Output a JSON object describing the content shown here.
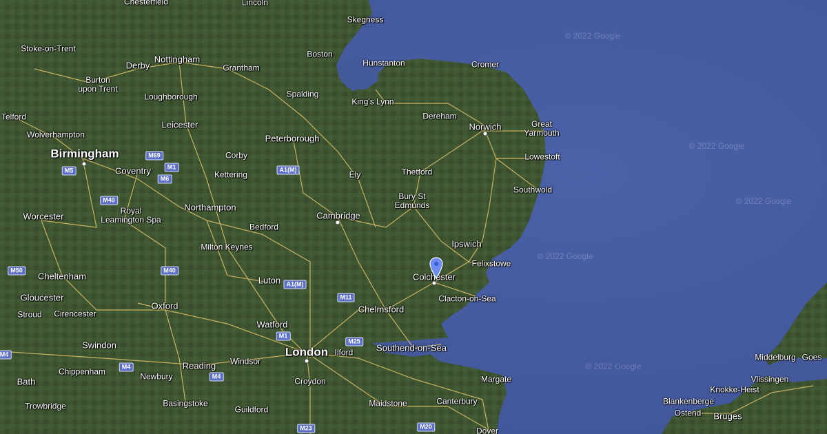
{
  "map": {
    "colors": {
      "sea": "#455a9e",
      "land": "#3d5430",
      "road": "#e8c86a"
    },
    "places": [
      {
        "name": "Chesterfield"
      },
      {
        "name": "Lincoln"
      },
      {
        "name": "Skegness"
      },
      {
        "name": "Stoke-on-Trent"
      },
      {
        "name": "Nottingham"
      },
      {
        "name": "Boston"
      },
      {
        "name": "Derby"
      },
      {
        "name": "Grantham"
      },
      {
        "name": "Hunstanton"
      },
      {
        "name": "Cromer"
      },
      {
        "name": "Burton\nupon Trent"
      },
      {
        "name": "Spalding"
      },
      {
        "name": "Loughborough"
      },
      {
        "name": "King's Lynn"
      },
      {
        "name": "Telford"
      },
      {
        "name": "Dereham"
      },
      {
        "name": "Leicester"
      },
      {
        "name": "Norwich"
      },
      {
        "name": "Great\nYarmouth"
      },
      {
        "name": "Wolverhampton"
      },
      {
        "name": "Peterborough"
      },
      {
        "name": "Birmingham"
      },
      {
        "name": "Corby"
      },
      {
        "name": "Lowestoft"
      },
      {
        "name": "Coventry"
      },
      {
        "name": "Kettering"
      },
      {
        "name": "Thetford"
      },
      {
        "name": "Ely"
      },
      {
        "name": "Southwold"
      },
      {
        "name": "Bury St\nEdmunds"
      },
      {
        "name": "Royal\nLeamington Spa"
      },
      {
        "name": "Northampton"
      },
      {
        "name": "Worcester"
      },
      {
        "name": "Cambridge"
      },
      {
        "name": "Bedford"
      },
      {
        "name": "Ipswich"
      },
      {
        "name": "Milton Keynes"
      },
      {
        "name": "Cheltenham"
      },
      {
        "name": "Felixstowe"
      },
      {
        "name": "Luton"
      },
      {
        "name": "Colchester"
      },
      {
        "name": "Gloucester"
      },
      {
        "name": "Clacton-on-Sea"
      },
      {
        "name": "Oxford"
      },
      {
        "name": "Stroud"
      },
      {
        "name": "Cirencester"
      },
      {
        "name": "Chelmsford"
      },
      {
        "name": "Watford"
      },
      {
        "name": "Swindon"
      },
      {
        "name": "London"
      },
      {
        "name": "Ilford"
      },
      {
        "name": "Southend-on-Sea"
      },
      {
        "name": "Reading"
      },
      {
        "name": "Windsor"
      },
      {
        "name": "Chippenham"
      },
      {
        "name": "Newbury"
      },
      {
        "name": "Croydon"
      },
      {
        "name": "Margate"
      },
      {
        "name": "Bath"
      },
      {
        "name": "Basingstoke"
      },
      {
        "name": "Maidstone"
      },
      {
        "name": "Canterbury"
      },
      {
        "name": "Trowbridge"
      },
      {
        "name": "Guildford"
      },
      {
        "name": "Dover"
      },
      {
        "name": "Middelburg"
      },
      {
        "name": "Goes"
      },
      {
        "name": "Vlissingen"
      },
      {
        "name": "Knokke-Heist"
      },
      {
        "name": "Blankenberge"
      },
      {
        "name": "Ostend"
      },
      {
        "name": "Bruges"
      }
    ],
    "roads": [
      "M69",
      "M1",
      "M5",
      "M6",
      "A1(M)",
      "M40",
      "M50",
      "A1(M)",
      "M11",
      "M25",
      "M1",
      "M4",
      "M4",
      "M4",
      "M23",
      "M20",
      "M4"
    ],
    "watermark": "© 2022 Google",
    "marker": "Colchester"
  }
}
